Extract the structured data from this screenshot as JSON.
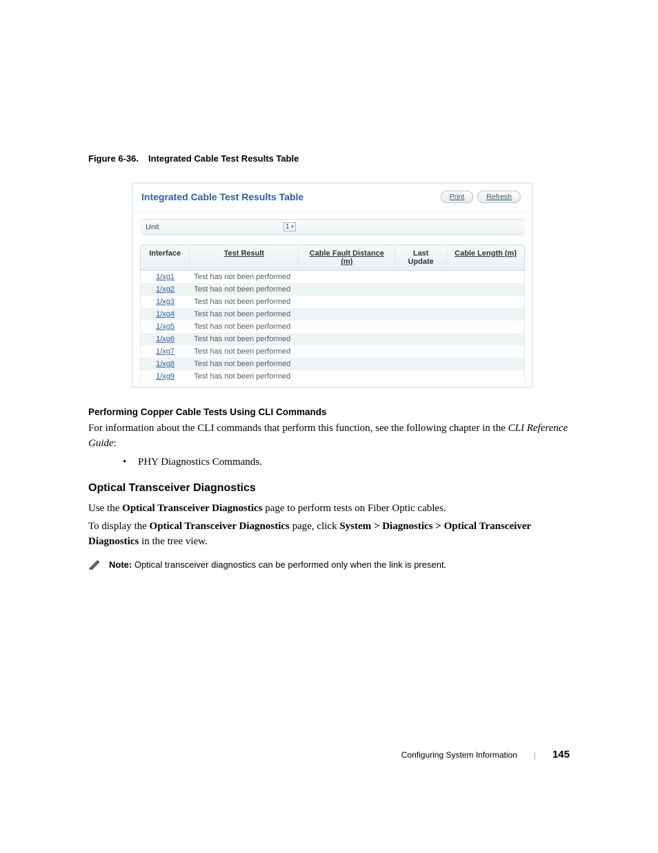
{
  "figure": {
    "label": "Figure 6-36.",
    "title": "Integrated Cable Test Results Table"
  },
  "screenshot": {
    "title": "Integrated Cable Test Results Table",
    "buttons": {
      "print": "Print",
      "refresh": "Refresh"
    },
    "unit": {
      "label": "Unit",
      "value": "1"
    },
    "headers": {
      "interface": "Interface",
      "result": "Test Result",
      "distance": "Cable Fault Distance (m)",
      "update": "Last Update",
      "length": "Cable Length (m)"
    },
    "rows": [
      {
        "interface": "1/xg1",
        "result": "Test has not been performed"
      },
      {
        "interface": "1/xg2",
        "result": "Test has not been performed"
      },
      {
        "interface": "1/xg3",
        "result": "Test has not been performed"
      },
      {
        "interface": "1/xg4",
        "result": "Test has not been performed"
      },
      {
        "interface": "1/xg5",
        "result": "Test has not been performed"
      },
      {
        "interface": "1/xg6",
        "result": "Test has not been performed"
      },
      {
        "interface": "1/xg7",
        "result": "Test has not been performed"
      },
      {
        "interface": "1/xg8",
        "result": "Test has not been performed"
      },
      {
        "interface": "1/xg9",
        "result": "Test has not been performed"
      }
    ]
  },
  "sub1": {
    "heading": "Performing Copper Cable Tests Using CLI Commands",
    "para_a": "For information about the CLI commands that perform this function, see the following chapter in the ",
    "para_b": "CLI Reference Guide",
    "para_c": ":",
    "bullet": "PHY Diagnostics Commands."
  },
  "sub2": {
    "heading": "Optical Transceiver Diagnostics",
    "p1_a": "Use the ",
    "p1_b": "Optical Transceiver Diagnostics",
    "p1_c": " page to perform tests on Fiber Optic cables.",
    "p2_a": "To display the ",
    "p2_b": "Optical Transceiver Diagnostics",
    "p2_c": " page, click ",
    "p2_d": "System > Diagnostics > Optical Transceiver Diagnostics",
    "p2_e": " in the tree view."
  },
  "note": {
    "label": "Note:",
    "text": " Optical transceiver diagnostics can be performed only when the link is present."
  },
  "footer": {
    "section": "Configuring System Information",
    "page": "145"
  }
}
